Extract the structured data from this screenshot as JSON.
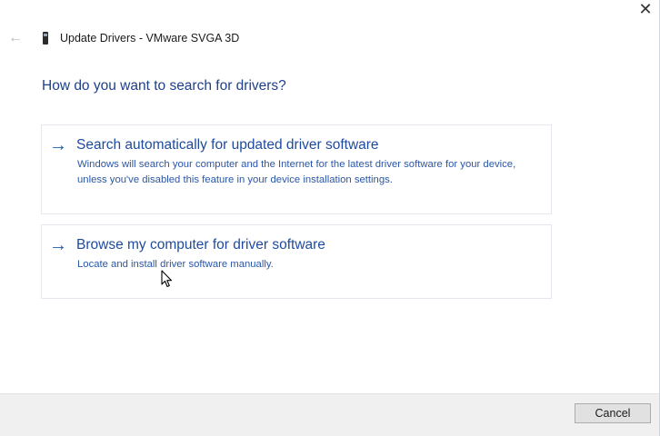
{
  "window": {
    "title": "Update Drivers - VMware SVGA 3D",
    "close_glyph": "✕",
    "back_glyph": "←"
  },
  "question": "How do you want to search for drivers?",
  "options": [
    {
      "arrow": "→",
      "title": "Search automatically for updated driver software",
      "description": "Windows will search your computer and the Internet for the latest driver software for your device, unless you've disabled this feature in your device installation settings."
    },
    {
      "arrow": "→",
      "title": "Browse my computer for driver software",
      "description": "Locate and install driver software manually."
    }
  ],
  "footer": {
    "cancel_label": "Cancel"
  },
  "colors": {
    "heading": "#1e3f8a",
    "link": "#1e4a9e",
    "footer_bg": "#f0f0f0"
  }
}
